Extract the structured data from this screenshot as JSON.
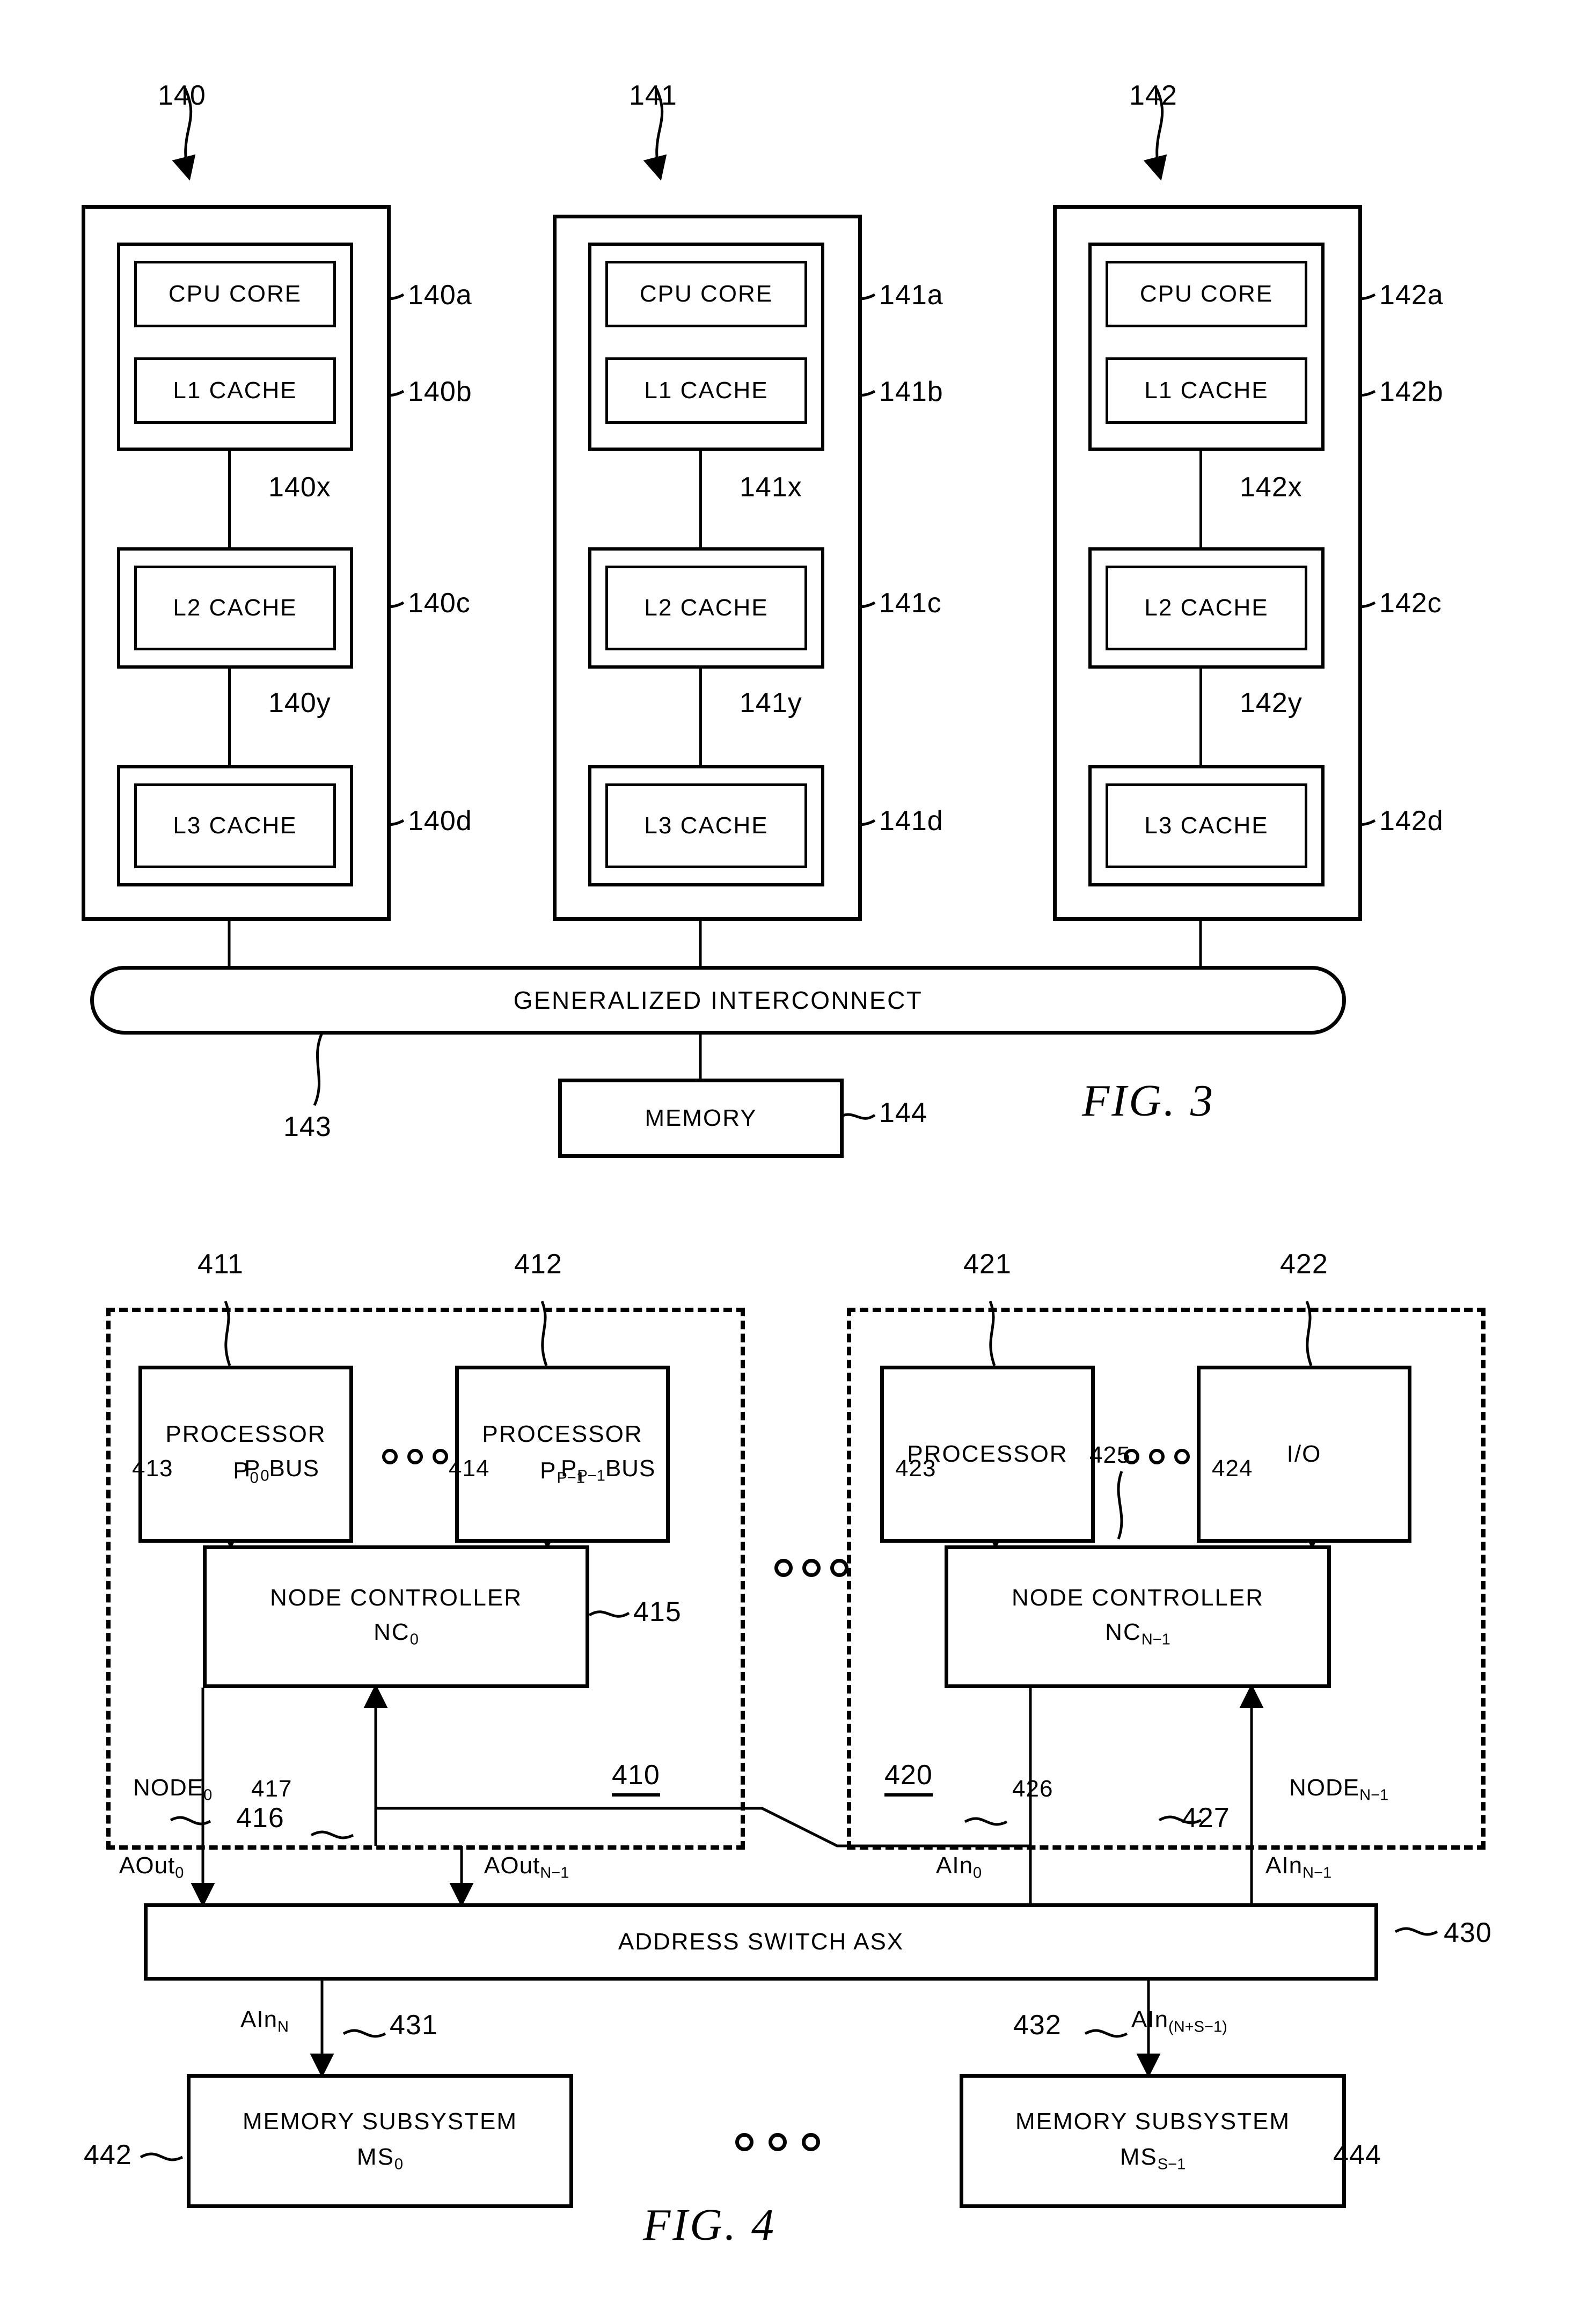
{
  "figures": [
    {
      "id": "fig3",
      "caption": "FIG.  3",
      "columns": [
        {
          "ref": "140",
          "cpu_core": {
            "label": "CPU CORE",
            "ref": "140a"
          },
          "l1_cache": {
            "label": "L1 CACHE",
            "ref": "140b"
          },
          "link_x": "140x",
          "l2_cache": {
            "label": "L2 CACHE",
            "ref": "140c"
          },
          "link_y": "140y",
          "l3_cache": {
            "label": "L3 CACHE",
            "ref": "140d"
          }
        },
        {
          "ref": "141",
          "cpu_core": {
            "label": "CPU CORE",
            "ref": "141a"
          },
          "l1_cache": {
            "label": "L1 CACHE",
            "ref": "141b"
          },
          "link_x": "141x",
          "l2_cache": {
            "label": "L2 CACHE",
            "ref": "141c"
          },
          "link_y": "141y",
          "l3_cache": {
            "label": "L3 CACHE",
            "ref": "141d"
          }
        },
        {
          "ref": "142",
          "cpu_core": {
            "label": "CPU CORE",
            "ref": "142a"
          },
          "l1_cache": {
            "label": "L1 CACHE",
            "ref": "142b"
          },
          "link_x": "142x",
          "l2_cache": {
            "label": "L2 CACHE",
            "ref": "142c"
          },
          "link_y": "142y",
          "l3_cache": {
            "label": "L3 CACHE",
            "ref": "142d"
          }
        }
      ],
      "interconnect": {
        "label": "GENERALIZED INTERCONNECT",
        "ref": "143"
      },
      "memory": {
        "label": "MEMORY",
        "ref": "144"
      }
    },
    {
      "id": "fig4",
      "caption": "FIG.  4",
      "node_left": {
        "ref": "410",
        "name_prefix": "NODE",
        "name_sub": "0",
        "proc_first": {
          "line1": "PROCESSOR",
          "line2_base": "P",
          "line2_sub": "0",
          "ref": "411"
        },
        "proc_last": {
          "line1": "PROCESSOR",
          "line2_base": "P",
          "line2_sub": "P−1",
          "ref": "412"
        },
        "bus_first": {
          "base": "P",
          "sub": "0",
          "tail": "BUS",
          "ref": "413"
        },
        "bus_last": {
          "base": "P",
          "sub": "P−1",
          "tail": "BUS",
          "ref": "414"
        },
        "controller": {
          "line1": "NODE CONTROLLER",
          "line2_base": "NC",
          "line2_sub": "0",
          "ref": "415"
        },
        "out_ref": "416",
        "in_ref": "417"
      },
      "node_right": {
        "ref": "420",
        "name_prefix": "NODE",
        "name_sub": "N−1",
        "proc_first": {
          "line1": "PROCESSOR",
          "ref": "421"
        },
        "io": {
          "line1": "I/O",
          "ref": "422"
        },
        "bus_first_ref": "423",
        "bus_last_ref": "424",
        "controller": {
          "line1": "NODE CONTROLLER",
          "line2_base": "NC",
          "line2_sub": "N−1",
          "ref": "425"
        },
        "out_ref": "426",
        "in_ref": "427"
      },
      "signals": {
        "aout0": {
          "base": "AOut",
          "sub": "0"
        },
        "aoutN1": {
          "base": "AOut",
          "sub": "N−1"
        },
        "ain0": {
          "base": "AIn",
          "sub": "0"
        },
        "ainN1": {
          "base": "AIn",
          "sub": "N−1"
        },
        "ainN": {
          "base": "AIn",
          "sub": "N"
        },
        "ainNS1": {
          "base": "AIn",
          "sub": "(N+S−1)"
        }
      },
      "address_switch": {
        "label": "ADDRESS SWITCH ASX",
        "ref": "430"
      },
      "mem_left": {
        "line1": "MEMORY SUBSYSTEM",
        "line2_base": "MS",
        "line2_sub": "0",
        "ref": "442",
        "link_ref": "431"
      },
      "mem_right": {
        "line1": "MEMORY SUBSYSTEM",
        "line2_base": "MS",
        "line2_sub": "S−1",
        "ref": "444",
        "link_ref": "432"
      }
    }
  ]
}
